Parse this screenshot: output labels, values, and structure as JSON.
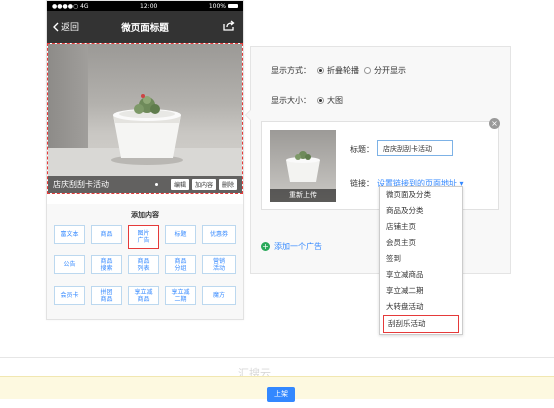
{
  "status": {
    "signal": "●●●●○ 4G",
    "time": "12:00",
    "battery": "100%"
  },
  "nav": {
    "back_label": "返回",
    "title": "微页面标题"
  },
  "ad": {
    "caption": "店庆刮刮卡活动",
    "buttons": [
      "编辑",
      "加内容",
      "删除"
    ]
  },
  "add_content": {
    "heading": "添加内容",
    "buttons": [
      {
        "label": "富文本",
        "selected": false
      },
      {
        "label": "商品",
        "selected": false
      },
      {
        "label": "图片\n广告",
        "selected": true
      },
      {
        "label": "标题",
        "selected": false
      },
      {
        "label": "优惠券",
        "selected": false
      },
      {
        "label": "公告",
        "selected": false
      },
      {
        "label": "商品\n搜索",
        "selected": false
      },
      {
        "label": "商品\n列表",
        "selected": false
      },
      {
        "label": "商品\n分组",
        "selected": false
      },
      {
        "label": "营销\n活动",
        "selected": false
      },
      {
        "label": "会员卡",
        "selected": false
      },
      {
        "label": "拼团\n商品",
        "selected": false
      },
      {
        "label": "享立减\n商品",
        "selected": false
      },
      {
        "label": "享立减\n二期",
        "selected": false
      },
      {
        "label": "魔方",
        "selected": false
      }
    ]
  },
  "settings": {
    "display_mode_label": "显示方式：",
    "display_mode_options": [
      "折叠轮播",
      "分开显示"
    ],
    "display_mode_selected": "折叠轮播",
    "display_size_label": "显示大小：",
    "display_size_option": "大图",
    "reupload_label": "重新上传",
    "title_label": "标题：",
    "title_value": "店庆刮刮卡活动",
    "link_label": "链接：",
    "link_value": "设置链接到的页面地址 ▾",
    "add_ad_label": "添加一个广告"
  },
  "link_menu": {
    "items": [
      "微页面及分类",
      "商品及分类",
      "店铺主页",
      "会员主页",
      "签到",
      "享立减商品",
      "享立减二期",
      "大转盘活动",
      "刮刮乐活动"
    ],
    "selected": "刮刮乐活动"
  },
  "footer": {
    "watermark": "汇搜云",
    "publish_label": "上架"
  },
  "colors": {
    "accent": "#3388ff",
    "highlight": "#e53a3a",
    "navbar": "#333333"
  }
}
